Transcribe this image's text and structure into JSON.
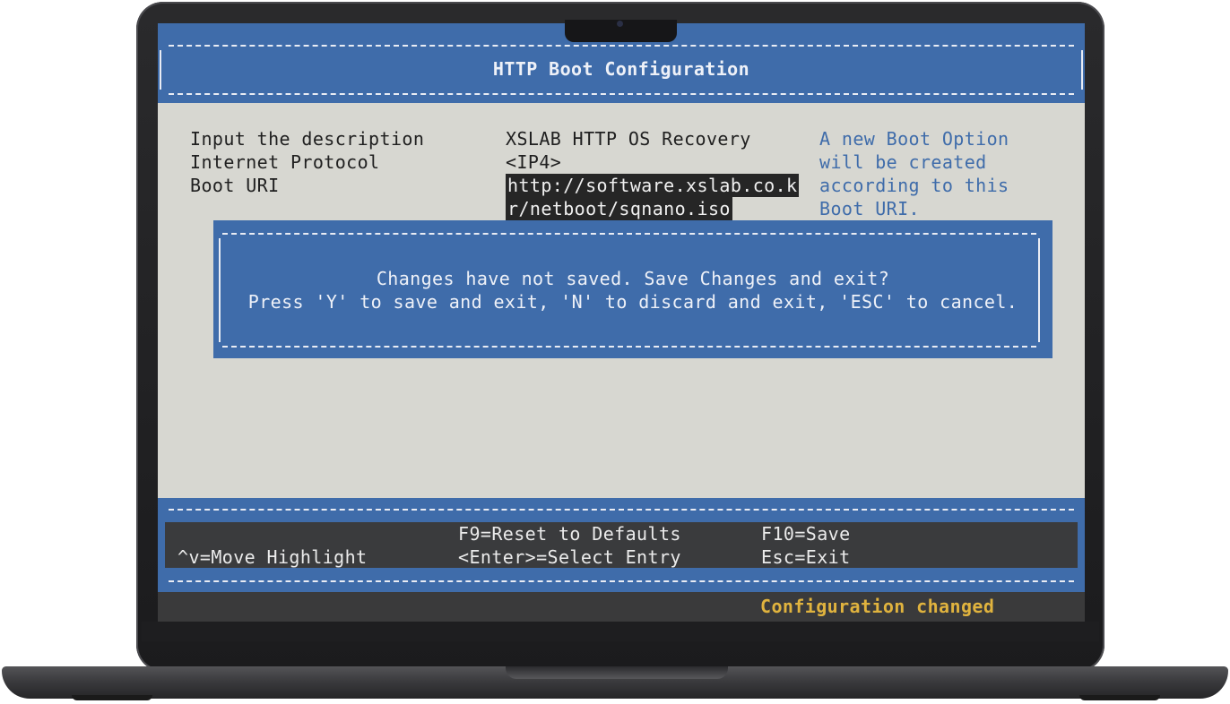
{
  "header": {
    "title": "HTTP Boot Configuration"
  },
  "form": {
    "description_label": "Input the description",
    "description_value": "XSLAB HTTP OS Recovery",
    "protocol_label": "Internet Protocol",
    "protocol_value": "<IP4>",
    "uri_label": "Boot URI",
    "uri_line1": "http://software.xslab.co.k",
    "uri_line2": "r/netboot/sqnano.iso"
  },
  "help": {
    "line1": "A new Boot Option",
    "line2": "will be created",
    "line3": "according to this",
    "line4": "Boot URI."
  },
  "dialog": {
    "message": "Changes have not saved. Save Changes and exit?",
    "instructions": "Press 'Y' to save and exit, 'N' to discard and exit, 'ESC' to cancel."
  },
  "footer": {
    "reset": "F9=Reset to Defaults",
    "save": "F10=Save",
    "move": "^v=Move Highlight",
    "select": "<Enter>=Select Entry",
    "exit": "Esc=Exit"
  },
  "status": "Configuration changed",
  "colors": {
    "panel_blue": "#3f6caa",
    "screen_bg": "#d7d7d1",
    "status_yellow": "#e0b33e"
  }
}
